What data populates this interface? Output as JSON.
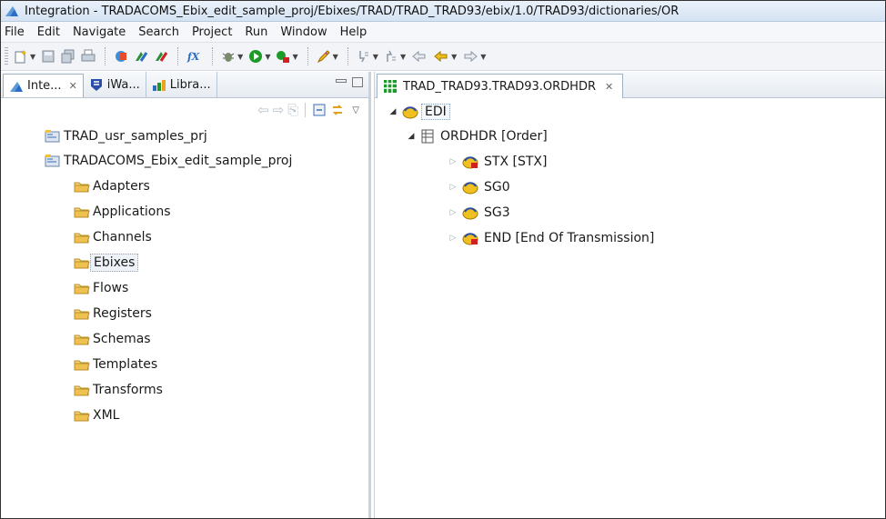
{
  "window": {
    "title": "Integration - TRADACOMS_Ebix_edit_sample_proj/Ebixes/TRAD/TRAD_TRAD93/ebix/1.0/TRAD93/dictionaries/OR"
  },
  "menu": [
    "File",
    "Edit",
    "Navigate",
    "Search",
    "Project",
    "Run",
    "Window",
    "Help"
  ],
  "toolbar": {
    "icons": [
      "new-wizard-icon",
      "save-icon",
      "save-all-icon",
      "print-icon",
      "web-service-icon",
      "ebix-icon",
      "ebix-alt-icon",
      "fx-icon",
      "debug-icon",
      "run-icon",
      "external-tools-icon",
      "pencil-icon",
      "next-annotation-icon",
      "previous-annotation-icon",
      "last-edit-icon",
      "back-icon",
      "forward-icon"
    ]
  },
  "left_panel": {
    "tabs": [
      {
        "label": "Inte...",
        "icon": "integration-icon",
        "close": "✕"
      },
      {
        "label": "iWa...",
        "icon": "iway-icon"
      },
      {
        "label": "Libra...",
        "icon": "library-icon"
      }
    ],
    "tree": [
      {
        "label": "TRAD_usr_samples_prj",
        "type": "project"
      },
      {
        "label": "TRADACOMS_Ebix_edit_sample_proj",
        "type": "project"
      },
      {
        "label": "Adapters",
        "type": "folder"
      },
      {
        "label": "Applications",
        "type": "folder"
      },
      {
        "label": "Channels",
        "type": "folder"
      },
      {
        "label": "Ebixes",
        "type": "folder",
        "selected": true
      },
      {
        "label": "Flows",
        "type": "folder"
      },
      {
        "label": "Registers",
        "type": "folder"
      },
      {
        "label": "Schemas",
        "type": "folder"
      },
      {
        "label": "Templates",
        "type": "folder"
      },
      {
        "label": "Transforms",
        "type": "folder"
      },
      {
        "label": "XML",
        "type": "folder"
      }
    ]
  },
  "editor": {
    "tab": {
      "label": "TRAD_TRAD93.TRAD93.ORDHDR",
      "close": "✕"
    },
    "tree": {
      "root": "EDI",
      "message": "ORDHDR [Order]",
      "children": [
        "STX [STX]",
        "SG0",
        "SG3",
        "END [End Of Transmission]"
      ]
    }
  },
  "colors": {
    "accent": "#2b6cc4",
    "folder": "#e6b84a",
    "run_green": "#1d9a2a",
    "segment_yellow": "#f0c020",
    "segment_red": "#d02020"
  }
}
